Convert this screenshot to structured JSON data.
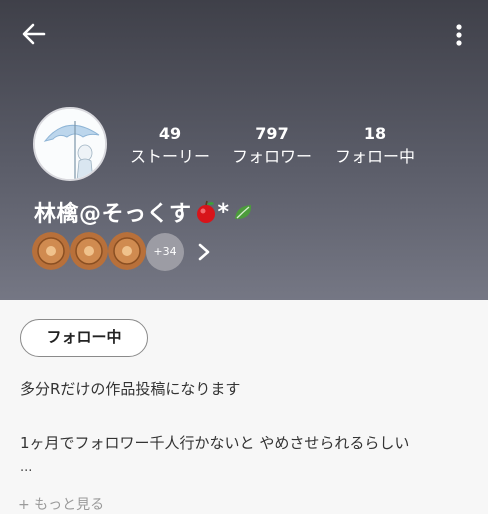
{
  "header": {
    "stats": [
      {
        "value": "49",
        "label": "ストーリー"
      },
      {
        "value": "797",
        "label": "フォロワー"
      },
      {
        "value": "18",
        "label": "フォロー中"
      }
    ],
    "username": "林檎@そっくす",
    "username_suffix": "*",
    "badges_more": "+34"
  },
  "profile": {
    "follow_button": "フォロー中",
    "bio_line1": "多分Rだけの作品投稿になります",
    "bio_line2": "1ヶ月でフォロワー千人行かないと やめさせられるらしい",
    "ellipsis": "...",
    "see_more": "+ もっと見る"
  },
  "colors": {
    "header_top": "#3f4049",
    "header_bottom": "#757784",
    "badge_bronze": "#b8703a"
  },
  "icons": [
    "back-arrow-icon",
    "more-vert-icon",
    "apple-emoji-icon",
    "leaf-emoji-icon",
    "chevron-right-icon"
  ]
}
